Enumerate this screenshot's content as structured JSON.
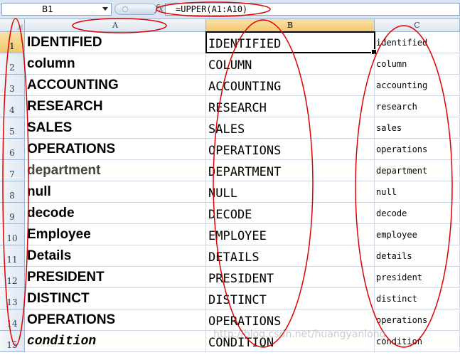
{
  "formula_bar": {
    "name_box": "B1",
    "fx_symbol": "fx",
    "formula": "=UPPER(A1:A10)"
  },
  "columns": [
    "A",
    "B",
    "C"
  ],
  "rows": [
    {
      "n": "1",
      "a": "IDENTIFIED",
      "b": "IDENTIFIED",
      "c": "identified"
    },
    {
      "n": "2",
      "a": "column",
      "b": "COLUMN",
      "c": "column"
    },
    {
      "n": "3",
      "a": "ACCOUNTING",
      "b": "ACCOUNTING",
      "c": "accounting"
    },
    {
      "n": "4",
      "a": "RESEARCH",
      "b": "RESEARCH",
      "c": "research"
    },
    {
      "n": "5",
      "a": "SALES",
      "b": "SALES",
      "c": "sales"
    },
    {
      "n": "6",
      "a": "OPERATIONS",
      "b": "OPERATIONS",
      "c": "operations"
    },
    {
      "n": "7",
      "a": "department",
      "b": "DEPARTMENT",
      "c": "department"
    },
    {
      "n": "8",
      "a": "null",
      "b": "NULL",
      "c": "null"
    },
    {
      "n": "9",
      "a": "decode",
      "b": "DECODE",
      "c": "decode"
    },
    {
      "n": "10",
      "a": "Employee",
      "b": "EMPLOYEE",
      "c": "employee"
    },
    {
      "n": "11",
      "a": "Details",
      "b": "DETAILS",
      "c": "details"
    },
    {
      "n": "12",
      "a": "PRESIDENT",
      "b": "PRESIDENT",
      "c": "president"
    },
    {
      "n": "13",
      "a": "DISTINCT",
      "b": "DISTINCT",
      "c": "distinct"
    },
    {
      "n": "14",
      "a": "OPERATIONS",
      "b": "OPERATIONS",
      "c": "operations"
    },
    {
      "n": "15",
      "a": "condition",
      "b": "CONDITION",
      "c": "condition"
    }
  ],
  "watermark": "http://blog.csdn.net/huangyanlong",
  "colors": {
    "annotation": "#e00000",
    "selected_header": "#f3c86d",
    "gridline": "#d0d7e5"
  }
}
